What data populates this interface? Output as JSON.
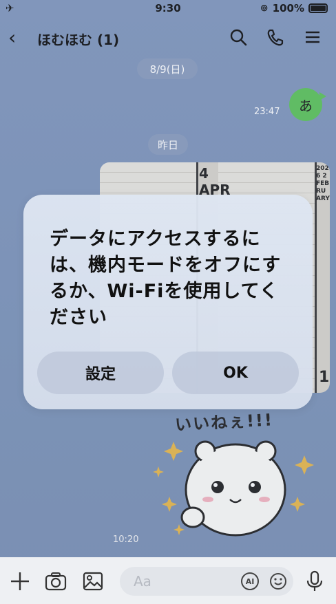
{
  "status_bar": {
    "time": "9:30",
    "battery_percent": "100%"
  },
  "header": {
    "title": "ほむほむ (1)"
  },
  "date_separators": {
    "first": "8/9(日)",
    "second": "昨日"
  },
  "messages": {
    "sent_text": "あ",
    "sent_time": "23:47",
    "sticker_time": "10:20",
    "sticker_caption": "いいねぇ!!!"
  },
  "calendar_image": {
    "labels": [
      "4 APR",
      "2026 2 FEBRUARY",
      "1"
    ]
  },
  "alert": {
    "message": "データにアクセスするには、機内モードをオフにするか、Wi-Fiを使用してください",
    "settings_label": "設定",
    "ok_label": "OK"
  },
  "input_bar": {
    "placeholder": "Aa",
    "ai_label": "AI"
  }
}
